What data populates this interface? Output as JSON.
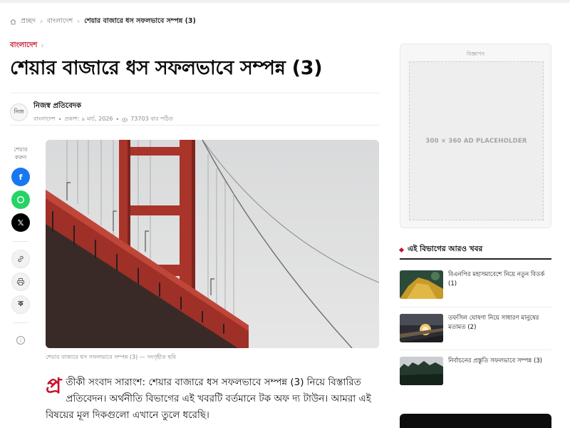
{
  "breadcrumb": {
    "home": "প্রচ্ছদ",
    "section": "বাংলাদেশ",
    "current": "শেয়ার বাজারে ধস সফলভাবে সম্পন্ন (3)"
  },
  "article": {
    "category": "বাংলাদেশ",
    "title": "শেয়ার বাজারে ধস সফলভাবে সম্পন্ন (3)",
    "author": {
      "avatar_text": "নিজ",
      "name": "নিজস্ব প্রতিবেদক",
      "section": "বাংলাদেশ",
      "published": "প্রকাশ: ৯ মার্চ, 2026",
      "views": "73703 বার পঠিত"
    },
    "image_caption": "শেয়ার বাজারে ধস সফলভাবে সম্পন্ন (3) — সংগৃহীত ছবি",
    "dropcap": "প্র",
    "lead": "তীকী সংবাদ সারাংশ: শেয়ার বাজারে ধস সফলভাবে সম্পন্ন (3) নিয়ে বিস্তারিত প্রতিবেদন। অর্থনীতি বিভাগের এই খবরটি বর্তমানে টক অফ দ্য টাউন। আমরা এই বিষয়ের মূল দিকগুলো এখানে তুলে ধরেছি।"
  },
  "share": {
    "label_line1": "শেয়ার",
    "label_line2": "করুন",
    "facebook": "f",
    "x": "𝕏",
    "ka": "ক",
    "info": "i"
  },
  "sidebar": {
    "ad_label": "বিজ্ঞাপন",
    "ad_placeholder": "300 × 360 AD PLACEHOLDER",
    "related_heading": "এই বিভাগের আরও খবর",
    "related": [
      {
        "title": "বিএনপির মহাসমাবেশে নিয়ে নতুন বিতর্ক (1)"
      },
      {
        "title": "তফসিল ঘোষণা নিয়ে সাধারণ মানুষের মতামত (2)"
      },
      {
        "title": "নির্বাচনের প্রস্তুতি সফলভাবে সম্পন্ন (3)"
      }
    ]
  },
  "colors": {
    "accent": "#c8102e",
    "facebook": "#1877f2",
    "whatsapp": "#25d366"
  }
}
